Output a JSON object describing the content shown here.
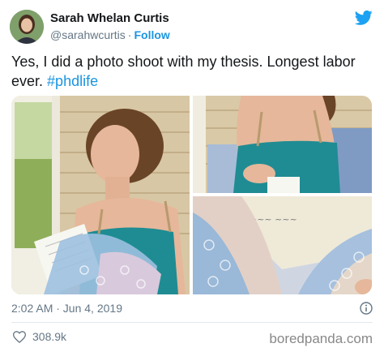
{
  "tweet": {
    "author_name": "Sarah Whelan Curtis",
    "handle": "@sarahwcurtis",
    "separator": "·",
    "follow_label": "Follow",
    "text": "Yes, I did a photo shoot with my thesis. Longest labor ever.",
    "hashtag": "#phdlife",
    "timestamp": "2:02 AM · Jun 4, 2019",
    "like_count": "308.9k"
  },
  "watermark": "boredpanda.com",
  "colors": {
    "accent": "#1b95e0",
    "secondary_text": "#657786",
    "divider": "#e1e8ed"
  },
  "icons": {
    "brand": "twitter-bird-icon",
    "info": "info-icon",
    "like": "heart-icon"
  }
}
